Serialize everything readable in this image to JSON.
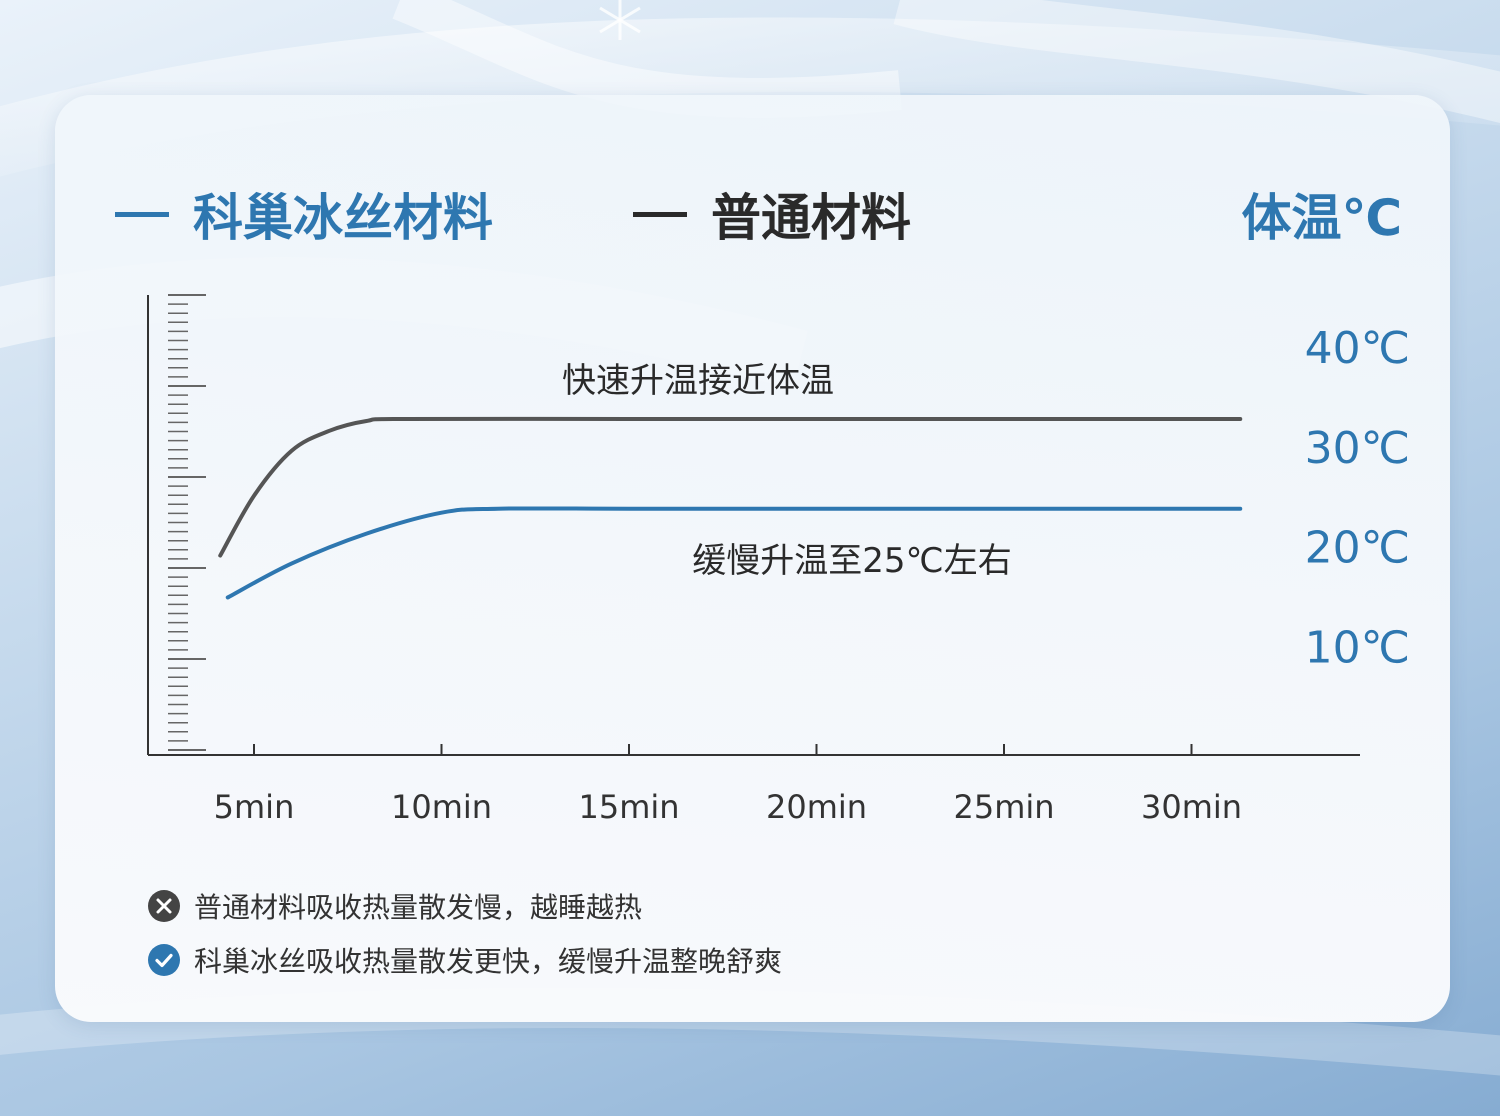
{
  "legend": {
    "keichao_label": "科巢冰丝材料",
    "normal_label": "普通材料"
  },
  "unit_title": "体温℃",
  "colors": {
    "keichao": "#2e77b0",
    "normal": "#555555",
    "axis": "#333333",
    "y_tick_label": "#2e77b0"
  },
  "chart_data": {
    "type": "line",
    "x_tick_labels": [
      "5min",
      "10min",
      "15min",
      "20min",
      "25min",
      "30min"
    ],
    "x_ticks": [
      5,
      10,
      15,
      20,
      25,
      30
    ],
    "y_tick_labels": [
      "40℃",
      "30℃",
      "20℃",
      "10℃"
    ],
    "y_ticks": [
      40,
      30,
      20,
      10
    ],
    "series": [
      {
        "name": "普通材料",
        "points": [
          [
            4.1,
            19
          ],
          [
            5,
            25
          ],
          [
            6,
            29.5
          ],
          [
            7,
            31.5
          ],
          [
            8,
            32.5
          ],
          [
            9,
            32.7
          ],
          [
            15,
            32.7
          ],
          [
            20,
            32.7
          ],
          [
            25,
            32.7
          ],
          [
            31.3,
            32.7
          ]
        ]
      },
      {
        "name": "科巢冰丝材料",
        "points": [
          [
            4.3,
            14.8
          ],
          [
            6,
            18.2
          ],
          [
            8,
            21.2
          ],
          [
            10,
            23.3
          ],
          [
            11.5,
            23.7
          ],
          [
            15,
            23.7
          ],
          [
            20,
            23.7
          ],
          [
            25,
            23.7
          ],
          [
            31.3,
            23.7
          ]
        ]
      }
    ],
    "annotations": [
      {
        "text": "快速升温接近体温"
      },
      {
        "text": "缓慢升温至25℃左右"
      }
    ]
  },
  "notes": [
    {
      "icon": "close-circle-icon",
      "text": "普通材料吸收热量散发慢，越睡越热"
    },
    {
      "icon": "check-circle-icon",
      "text": "科巢冰丝吸收热量散发更快，缓慢升温整晚舒爽"
    }
  ]
}
